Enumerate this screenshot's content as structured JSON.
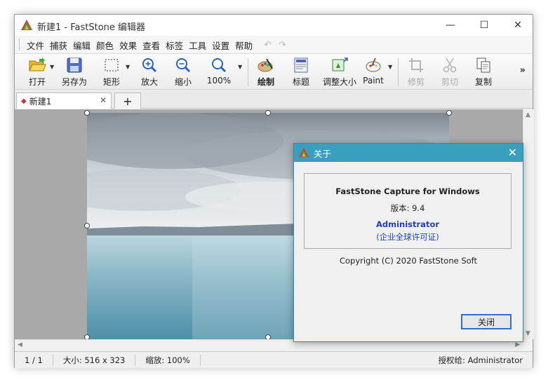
{
  "window": {
    "title": "新建1 - FastStone 编辑器",
    "minimize_glyph": "—",
    "maximize_glyph": "☐",
    "close_glyph": "✕"
  },
  "menu": {
    "items": [
      "文件",
      "捕获",
      "编辑",
      "颜色",
      "效果",
      "查看",
      "标签",
      "工具",
      "设置",
      "帮助"
    ],
    "undo_glyph": "↶",
    "redo_glyph": "↷"
  },
  "toolbar": {
    "open": "打开",
    "save_as": "另存为",
    "rectangle": "矩形",
    "zoom_in": "放大",
    "zoom_out": "缩小",
    "zoom_level": "100%",
    "draw": "绘制",
    "caption": "标题",
    "resize": "调整大小",
    "paint": "Paint",
    "crop": "修剪",
    "cut": "剪切",
    "copy": "复制",
    "more": "»"
  },
  "tabs": {
    "active_label": "新建1",
    "close_glyph": "✕",
    "add_glyph": "+"
  },
  "statusbar": {
    "page": "1 / 1",
    "size": "大小: 516 x 323",
    "zoom": "缩放: 100%",
    "license": "授权给: Administrator"
  },
  "dialog": {
    "title": "关于",
    "close_glyph": "✕",
    "product": "FastStone Capture for Windows",
    "version": "版本: 9.4",
    "user": "Administrator",
    "license": "(企业全球许可证)",
    "copyright": "Copyright (C) 2020 FastStone Soft",
    "ok_label": "关闭"
  },
  "colors": {
    "dialog_title_bg": "#3a9ebd",
    "link_blue": "#1f3fbf",
    "canvas_bg": "#a9a9a9"
  }
}
